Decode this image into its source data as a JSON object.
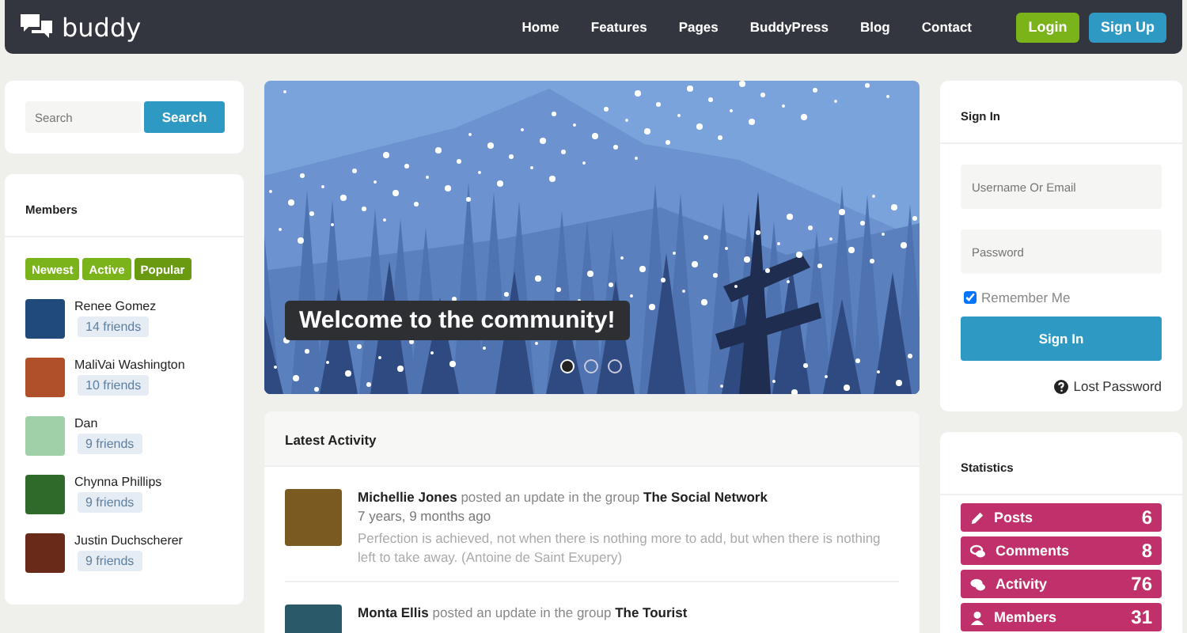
{
  "nav": {
    "logo": "buddy",
    "links": [
      "Home",
      "Features",
      "Pages",
      "BuddyPress",
      "Blog",
      "Contact"
    ],
    "buttons": [
      {
        "label": "Login",
        "kind": "login"
      },
      {
        "label": "Sign Up",
        "kind": "signup"
      }
    ]
  },
  "search": {
    "placeholder": "Search",
    "button": "Search"
  },
  "members": {
    "title": "Members",
    "filters": [
      {
        "label": "Newest",
        "selected": false
      },
      {
        "label": "Active",
        "selected": false
      },
      {
        "label": "Popular",
        "selected": true
      }
    ],
    "list": [
      {
        "name": "Renee Gomez",
        "friends": "14 friends",
        "color": "#1f4a7a"
      },
      {
        "name": "MaliVai Washington",
        "friends": "10 friends",
        "color": "#b0502a"
      },
      {
        "name": "Dan",
        "friends": "9 friends",
        "color": "#9fd0a8"
      },
      {
        "name": "Chynna Phillips",
        "friends": "9 friends",
        "color": "#2f6a2a"
      },
      {
        "name": "Justin Duchscherer",
        "friends": "9 friends",
        "color": "#6a2a1a"
      }
    ]
  },
  "slider": {
    "caption": "Welcome to the community!",
    "dots": [
      {
        "selected": true
      },
      {
        "selected": false
      },
      {
        "selected": false
      }
    ]
  },
  "activity": {
    "title": "Latest Activity",
    "items": [
      {
        "user": "Michellie Jones",
        "action": "posted an update in the group",
        "group": "The Social Network",
        "time": "7 years, 9 months ago",
        "text": "Perfection is achieved, not when there is nothing more to add, but when there is nothing left to take away. (Antoine de Saint Exupery)",
        "color": "#7a5a20"
      },
      {
        "user": "Monta Ellis",
        "action": "posted an update in the group",
        "group": "The Tourist",
        "color": "#2a5a6a"
      }
    ]
  },
  "signin": {
    "title": "Sign In",
    "username_placeholder": "Username Or Email",
    "password_placeholder": "Password",
    "remember": {
      "label": "Remember Me",
      "checked": true
    },
    "button": "Sign In",
    "lost_password": "Lost Password"
  },
  "statistics": {
    "title": "Statistics",
    "items": [
      {
        "label": "Posts",
        "count": "6",
        "kind": "posts"
      },
      {
        "label": "Comments",
        "count": "8",
        "kind": "comments"
      },
      {
        "label": "Activity",
        "count": "76",
        "kind": "activity"
      },
      {
        "label": "Members",
        "count": "31",
        "kind": "members"
      }
    ]
  }
}
